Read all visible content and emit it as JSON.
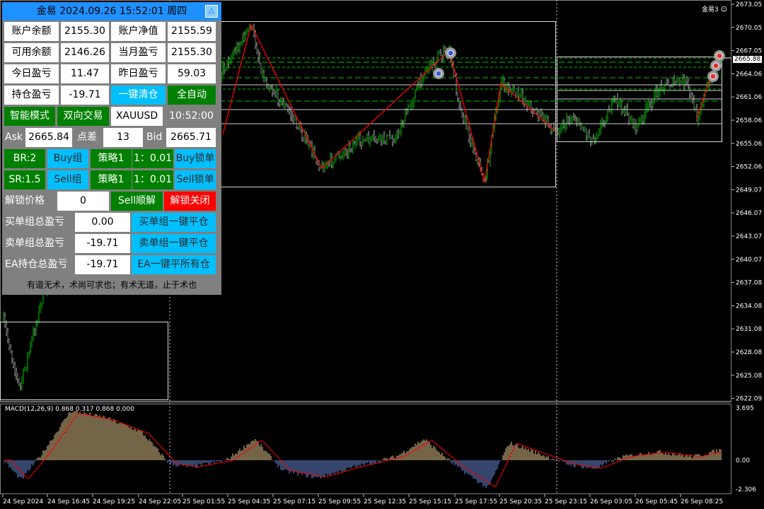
{
  "panel": {
    "title": "金易 2024.09.26 15:52:01 周四",
    "collapse_icon": "△",
    "rows": {
      "balance_label": "账户余额",
      "balance_value": "2155.30",
      "equity_label": "账户净值",
      "equity_value": "2155.59",
      "free_label": "可用余额",
      "free_value": "2146.26",
      "month_label": "当月盈亏",
      "month_value": "2155.30",
      "today_label": "今日盈亏",
      "today_value": "11.47",
      "yesterday_label": "昨日盈亏",
      "yesterday_value": "59.03",
      "position_label": "持仓盈亏",
      "position_value": "-19.71",
      "close_all_button": "一键清仓",
      "full_auto_button": "全自动"
    },
    "mode": {
      "smart": "智能模式",
      "bidirectional": "双向交易",
      "symbol": "XAUUSD",
      "time": "10:52:00"
    },
    "quote": {
      "ask_label": "Ask",
      "ask_value": "2665.84",
      "spread_label": "点差",
      "spread_value": "13",
      "bid_label": "Bid",
      "bid_value": "2665.71"
    },
    "grid": {
      "br": "BR:2",
      "buy_group": "Buy组",
      "strategy1": "策略1",
      "ratio1": "1：0.01",
      "buy_lock": "Buy锁单",
      "sr": "SR:1.5",
      "sell_group": "Sell组",
      "strategy2": "策略1",
      "ratio2": "1：0.01",
      "sell_lock": "Sell锁单"
    },
    "unlock": {
      "label": "解锁价格",
      "value": "0",
      "sell_unlock": "Sell顺解",
      "unlock_close": "解锁关闭"
    },
    "totals": {
      "buy_label": "买单组总盈亏",
      "buy_value": "0.00",
      "buy_close": "买单组一键平仓",
      "sell_label": "卖单组总盈亏",
      "sell_value": "-19.71",
      "sell_close": "卖单组一键平仓",
      "ea_label": "EA持仓总盈亏",
      "ea_value": "-19.71",
      "ea_close": "EA一键平所有仓"
    },
    "motto": "有道无术，术尚可求也；有术无道，止于术也"
  },
  "chart": {
    "ea_label": "金易3",
    "smile_icon": "smile-icon",
    "current_price": "2665.88",
    "price_ticks": [
      "2673.05",
      "2670.05",
      "2667.05",
      "2664.06",
      "2661.06",
      "2658.06",
      "2655.06",
      "2652.06",
      "2649.07",
      "2646.07",
      "2643.07",
      "2640.07",
      "2637.08",
      "2634.08",
      "2631.08",
      "2628.08",
      "2625.08",
      "2622.09"
    ],
    "macd_label": "MACD(12,26,9) 0.868 0.317 0.868 0.000",
    "macd_ticks": [
      "3.695",
      "0.00",
      "-2.306"
    ],
    "time_ticks": [
      "24 Sep 2024",
      "24 Sep 16:45",
      "24 Sep 19:25",
      "24 Sep 22:05",
      "25 Sep 01:55",
      "25 Sep 04:35",
      "25 Sep 07:15",
      "25 Sep 09:55",
      "25 Sep 12:35",
      "25 Sep 15:15",
      "25 Sep 17:55",
      "25 Sep 20:35",
      "25 Sep 23:15",
      "26 Sep 03:05",
      "26 Sep 05:45",
      "26 Sep 08:25"
    ],
    "colors": {
      "bull": "#00c000",
      "bear": "#c0c0c0",
      "zigzag": "#ff0000",
      "level": "#00c000",
      "macd_up": "#e8c890",
      "macd_down": "#6a8ad8",
      "signal": "#ff0000"
    }
  }
}
